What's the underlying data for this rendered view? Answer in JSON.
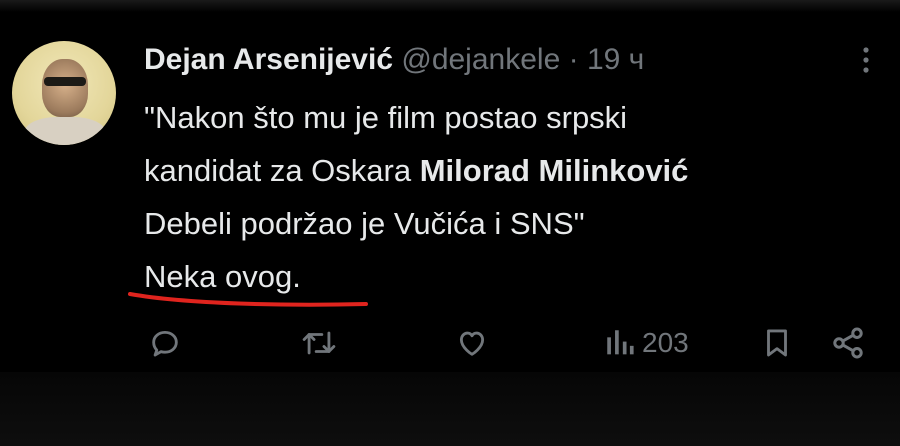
{
  "tweet": {
    "author_name": "Dejan Arsenijević",
    "handle": "@dejankele",
    "separator": "·",
    "time": "19 ч",
    "text_line1": "\"Nakon što mu je film postao srpski",
    "text_line2_prefix": "kandidat za Oskara ",
    "text_line2_bold": "Milorad Milinković",
    "text_line3": "Debeli podržao je Vučića i SNS\"",
    "text_line4": "Neka ovog.",
    "views": "203"
  },
  "colors": {
    "background": "#000000",
    "text": "#e7e9ea",
    "muted": "#71767b",
    "annotation_underline": "#e0241e"
  },
  "icons": [
    "more-icon",
    "reply-icon",
    "retweet-icon",
    "like-icon",
    "views-icon",
    "bookmark-icon",
    "share-icon"
  ]
}
